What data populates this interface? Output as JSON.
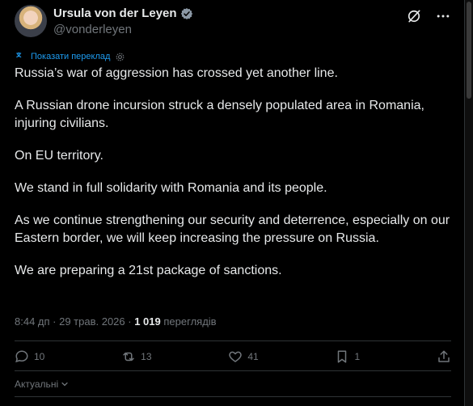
{
  "author": {
    "name": "Ursula von der Leyen",
    "handle": "@vonderleyen"
  },
  "translate": {
    "label": "Показати переклад"
  },
  "tweet": {
    "paragraphs": [
      "Russia’s war of aggression has crossed yet another line.",
      "A Russian drone incursion struck a densely populated area in Romania, injuring civilians.",
      "On EU territory.",
      "We stand in full solidarity with Romania and its people.",
      "As we continue strengthening our security and deterrence, especially on our Eastern border, we will keep increasing the pressure on Russia.",
      "We are preparing a 21st package of sanctions."
    ]
  },
  "meta": {
    "time": "8:44 дп",
    "separator1": " · ",
    "date": "29 трав. 2026",
    "separator2": " · ",
    "views_count": "1 019",
    "views_label": " переглядів"
  },
  "actions": {
    "replies": "10",
    "reposts": "13",
    "likes": "41",
    "bookmarks": "1"
  },
  "sort": {
    "label": "Актуальні"
  },
  "colors": {
    "background": "#000000",
    "text": "#e7e9ea",
    "muted": "#71767b",
    "accent": "#1d9bf0",
    "border": "#2f3336"
  }
}
